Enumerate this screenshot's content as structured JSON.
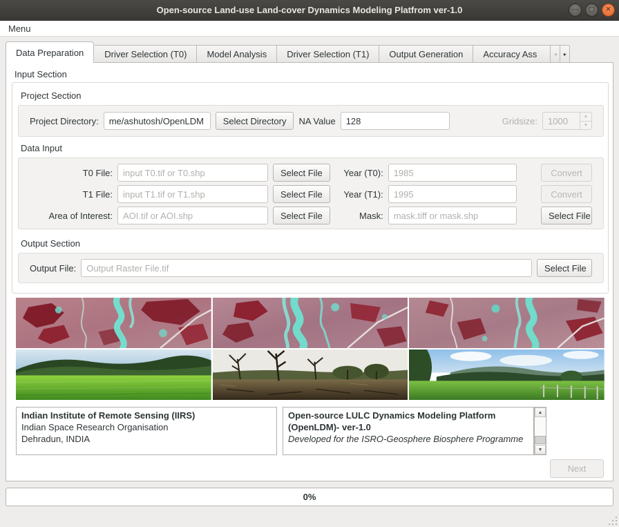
{
  "window": {
    "title": "Open-source Land-use Land-cover Dynamics Modeling Platfrom ver-1.0"
  },
  "icons": {
    "minimize": "—",
    "maximize": "▢",
    "close": "✕",
    "spin_up": "▲",
    "spin_down": "▼",
    "scroll_up": "▲",
    "scroll_down": "▼",
    "tab_left": "◂",
    "tab_right": "▸"
  },
  "menu": {
    "label": "Menu"
  },
  "tabs": {
    "items": [
      {
        "label": "Data Preparation",
        "active": true
      },
      {
        "label": "Driver Selection (T0)",
        "active": false
      },
      {
        "label": "Model Analysis",
        "active": false
      },
      {
        "label": "Driver Selection (T1)",
        "active": false
      },
      {
        "label": "Output Generation",
        "active": false
      },
      {
        "label": "Accuracy Ass",
        "active": false
      }
    ]
  },
  "content": {
    "input_section_title": "Input Section",
    "project": {
      "title": "Project Section",
      "directory_label": "Project Directory:",
      "directory_value": "me/ashutosh/OpenLDM",
      "select_directory": "Select Directory",
      "na_label": "NA Value",
      "na_value": "128",
      "gridsize_label": "Gridsize:",
      "gridsize_value": "1000"
    },
    "data_input": {
      "title": "Data Input",
      "rows": [
        {
          "label": "T0 File:",
          "placeholder": "input T0.tif or T0.shp",
          "select": "Select File",
          "right_label": "Year (T0):",
          "right_placeholder": "1985",
          "action": "Convert",
          "action_enabled": false
        },
        {
          "label": "T1 File:",
          "placeholder": "input T1.tif or T1.shp",
          "select": "Select File",
          "right_label": "Year (T1):",
          "right_placeholder": "1995",
          "action": "Convert",
          "action_enabled": false
        },
        {
          "label": "Area of Interest:",
          "placeholder": "AOI.tif or AOI.shp",
          "select": "Select File",
          "right_label": "Mask:",
          "right_placeholder": "mask.tiff or mask.shp",
          "action": "Select File",
          "action_enabled": true
        }
      ]
    },
    "output": {
      "title": "Output Section",
      "label": "Output File:",
      "placeholder": "Output Raster File.tif",
      "select": "Select File"
    },
    "gallery": {
      "images": [
        {
          "name": "false-color-satellite-scene-1"
        },
        {
          "name": "false-color-satellite-scene-2"
        },
        {
          "name": "false-color-satellite-scene-3"
        },
        {
          "name": "rice-field-with-forest-hills-photo"
        },
        {
          "name": "deforested-land-dead-trees-photo"
        },
        {
          "name": "pasture-with-fence-and-mountains-photo"
        }
      ]
    },
    "info_left": {
      "line1": "Indian Institute of Remote Sensing (IIRS)",
      "line2": "Indian Space Research Organisation",
      "line3": "Dehradun, INDIA"
    },
    "info_right": {
      "line1": "Open-source LULC Dynamics Modeling Platform (OpenLDM)- ver-1.0",
      "line2": "Developed for the ISRO-Geosphere Biosphere Programme"
    },
    "next_label": "Next",
    "progress_value": "0%"
  }
}
